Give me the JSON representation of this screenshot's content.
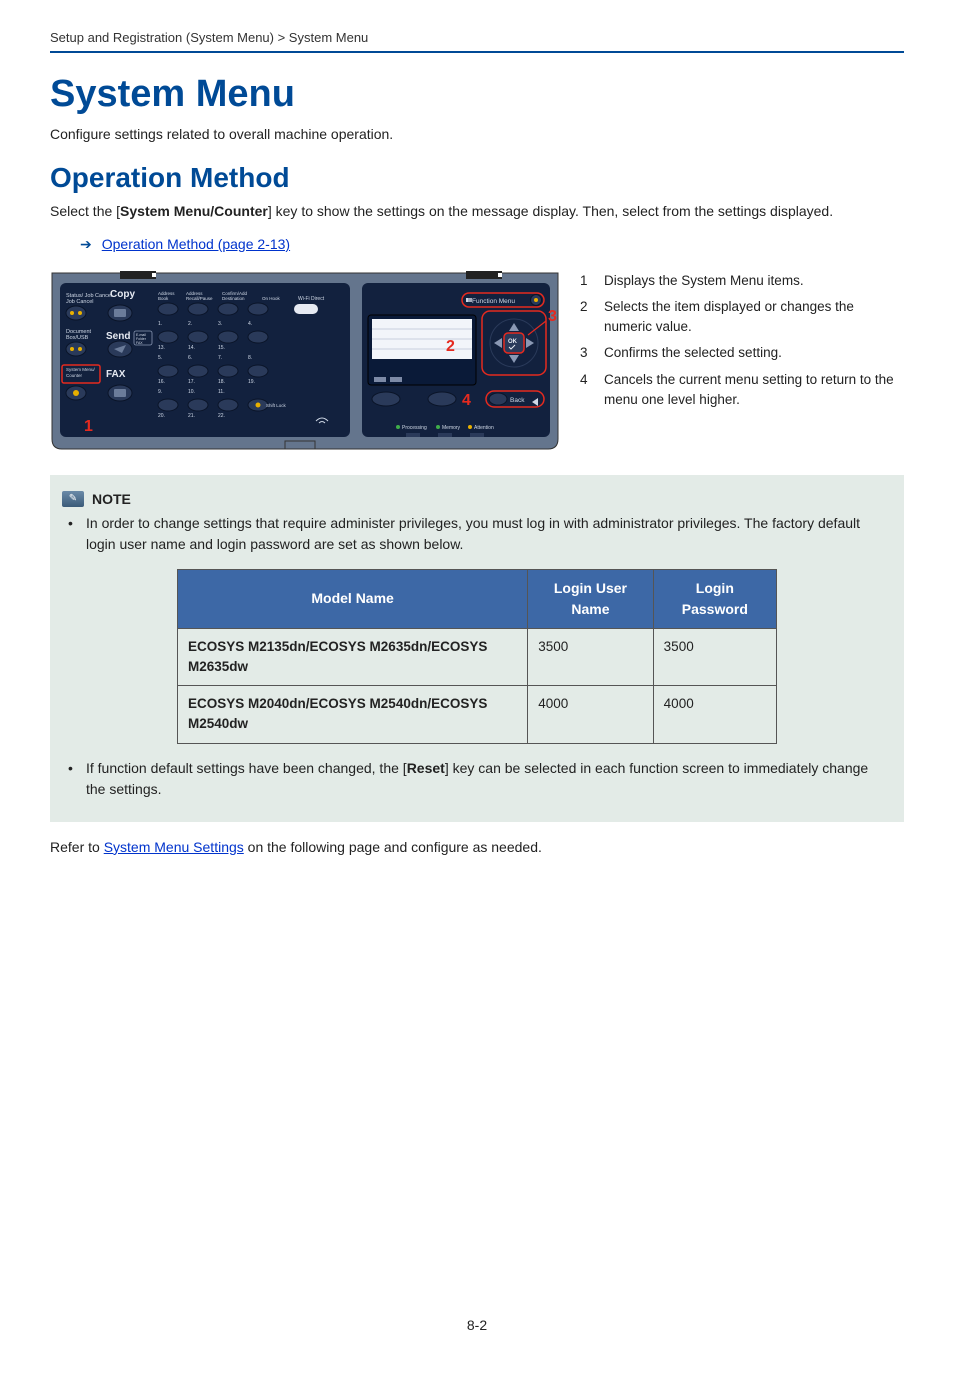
{
  "breadcrumb": "Setup and Registration (System Menu) > System Menu",
  "title": "System Menu",
  "intro": "Configure settings related to overall machine operation.",
  "subheading": "Operation Method",
  "body_pre": "Select the [",
  "body_bold": "System Menu/Counter",
  "body_post": "] key to show the settings on the message display. Then, select from the settings displayed.",
  "xref_text": "Operation Method (page 2-13)",
  "panel": {
    "left": {
      "status": "Status/\nJob Cancel",
      "copy": "Copy",
      "docbox": "Document\nBox/USB",
      "send": "Send",
      "sysmenu": "System Menu/\nCounter",
      "fax": "FAX",
      "addrbook": "Address\nBook",
      "recall": "Address\nRecall/Pause",
      "confirm": "Confirm/Add\nDestination",
      "onhook": "On Hook",
      "wifi": "Wi-Fi Direct",
      "emailfax": "E-mail\nFolder\nFAX",
      "shift": "Shift Lock",
      "nums_row1": "1.  2.  3.  4.",
      "nums_row1b": "13.  14.  15.",
      "nums_row2": "5.  6.  7.  8.",
      "nums_row2b": "16.  17.  18.  19.",
      "nums_row3": "9.  10.  11.",
      "nums_row3b": "20.  21.  22."
    },
    "right": {
      "funcmenu": "Function Menu",
      "back": "Back",
      "ok": "OK",
      "status": "Processing   Memory   Attention"
    },
    "callout1": "1",
    "callout2": "2",
    "callout3": "3",
    "callout4": "4"
  },
  "legend": [
    {
      "n": "1",
      "t": "Displays the System Menu items."
    },
    {
      "n": "2",
      "t": "Selects the item displayed or changes the numeric value."
    },
    {
      "n": "3",
      "t": "Confirms the selected setting."
    },
    {
      "n": "4",
      "t": "Cancels the current menu setting to return to the menu one level higher."
    }
  ],
  "note": {
    "label": "NOTE",
    "li1": "In order to change settings that require administer privileges, you must log in with administrator privileges. The factory default login user name and login password are set as shown below.",
    "li2_pre": "If function default settings have been changed, the [",
    "li2_bold": "Reset",
    "li2_post": "] key can be selected in each function screen to immediately change the settings."
  },
  "table": {
    "h1": "Model Name",
    "h2": "Login User Name",
    "h3": "Login Password",
    "rows": [
      {
        "model": "ECOSYS M2135dn/ECOSYS M2635dn/ECOSYS M2635dw",
        "user": "3500",
        "pass": "3500"
      },
      {
        "model": "ECOSYS M2040dn/ECOSYS M2540dn/ECOSYS M2540dw",
        "user": "4000",
        "pass": "4000"
      }
    ]
  },
  "closing_pre": "Refer to ",
  "closing_link": "System Menu Settings",
  "closing_post": " on the following page and configure as needed.",
  "pagenum": "8-2"
}
